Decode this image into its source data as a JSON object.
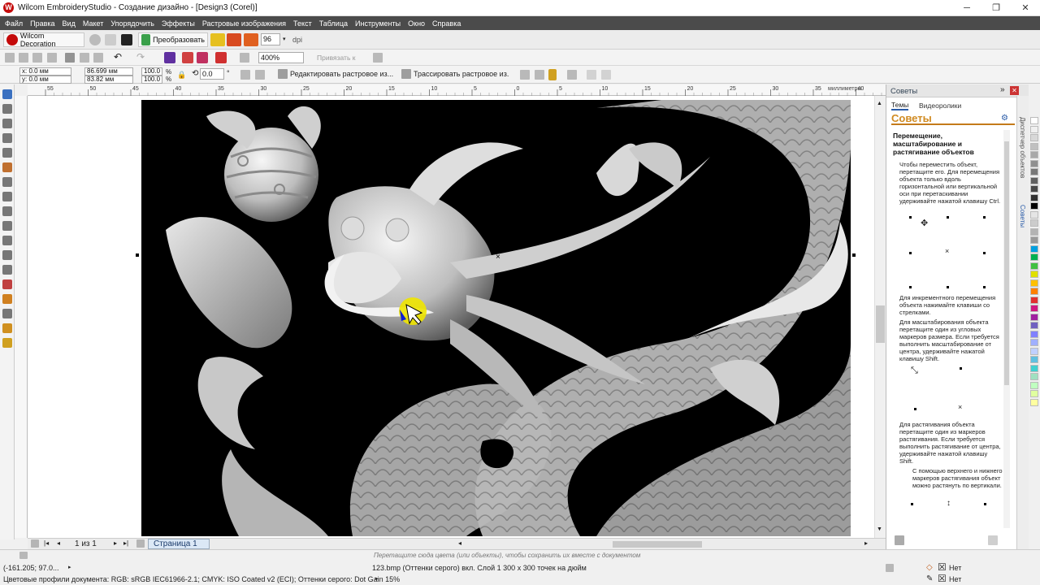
{
  "window": {
    "title": "Wilcom EmbroideryStudio - Создание дизайно - [Design3 (Corel)]",
    "minimize": "─",
    "maximize": "❐",
    "close": "✕"
  },
  "menu": [
    "Файл",
    "Правка",
    "Вид",
    "Макет",
    "Упорядочить",
    "Эффекты",
    "Растровые изображения",
    "Текст",
    "Таблица",
    "Инструменты",
    "Окно",
    "Справка"
  ],
  "toolbar1": {
    "wilcom_label": "Wilcom Decoration",
    "convert_label": "Преобразовать",
    "dpi_value": "96",
    "dpi_label": "dpi"
  },
  "toolbar2": {
    "zoom": "400%",
    "snap_label": "Привязать к"
  },
  "propbar": {
    "x": "x: 0.0 мм",
    "y": "y: 0.0 мм",
    "w": "86.699 мм",
    "h": "83.82 мм",
    "sx": "100.0",
    "sy": "100.0",
    "pct": "%",
    "angle": "0.0",
    "deg": "°",
    "edit_bitmap": "Редактировать растровое из...",
    "trace_bitmap": "Трассировать растровое из."
  },
  "ruler": {
    "units": "миллиметры",
    "ticks": [
      "55",
      "50",
      "45",
      "40",
      "35",
      "30",
      "25",
      "20",
      "15",
      "10",
      "5",
      "0",
      "5",
      "10",
      "15",
      "20",
      "25",
      "30",
      "35",
      "40"
    ]
  },
  "pages": {
    "count": "1 из 1",
    "tab": "Страница 1"
  },
  "hint": "Перетащите сюда цвета (или объекты), чтобы сохранить их вместе с документом",
  "docker": {
    "title": "Советы",
    "tabs": [
      "Темы",
      "Видеоролики"
    ],
    "header": "Советы",
    "heading": "Перемещение, масштабирование и растягивание объектов",
    "p1": "Чтобы переместить объект, перетащите его. Для перемещения объекта только вдоль горизонтальной или вертикальной оси при перетаскивании удерживайте нажатой клавишу Ctrl.",
    "p2": "Для инкрементного перемещения объекта нажимайте клавиши со стрелками.",
    "p3": "Для масштабирования объекта перетащите один из угловых маркеров размера. Если требуется выполнить масштабирование от центра, удерживайте нажатой клавишу Shift.",
    "p4": "Для растягивания объекта перетащите один из маркеров растягивания. Если требуется выполнить растягивание от центра, удерживайте нажатой клавишу Shift.",
    "p5": "С помощью верхнего и нижнего маркеров растягивания объект можно растянуть по вертикали.",
    "side_tabs": [
      "Диспетчер объектов",
      "Советы"
    ]
  },
  "status": {
    "coords": "(-161.205; 97.0...",
    "object": "123.bmp (Оттенки серого) вкл. Слой 1 300 x 300 точек на дюйм",
    "profiles": "Цветовые профили документа: RGB: sRGB IEC61966-2.1; CMYK: ISO Coated v2 (ECI); Оттенки серого: Dot Gain 15%",
    "fill_none": "Нет",
    "outline_none": "Нет"
  },
  "palette_colors": [
    "#ffffff",
    "#f0f0f0",
    "#d8d8d8",
    "#c0c0c0",
    "#a8a8a8",
    "#909090",
    "#787878",
    "#606060",
    "#484848",
    "#303030",
    "#000000",
    "#e5e5e5",
    "#cccccc",
    "#b3b3b3",
    "#999999",
    "#00a0e0",
    "#00b050",
    "#40c040",
    "#e0e000",
    "#ffc000",
    "#ff8000",
    "#e03030",
    "#d01880",
    "#a020a0",
    "#7060c0",
    "#8080ff",
    "#a0b0ff",
    "#c0d0ff",
    "#60c0e0",
    "#40d0d0",
    "#a0e0c0",
    "#c0ffc0",
    "#e0ffa0",
    "#ffffa0"
  ]
}
